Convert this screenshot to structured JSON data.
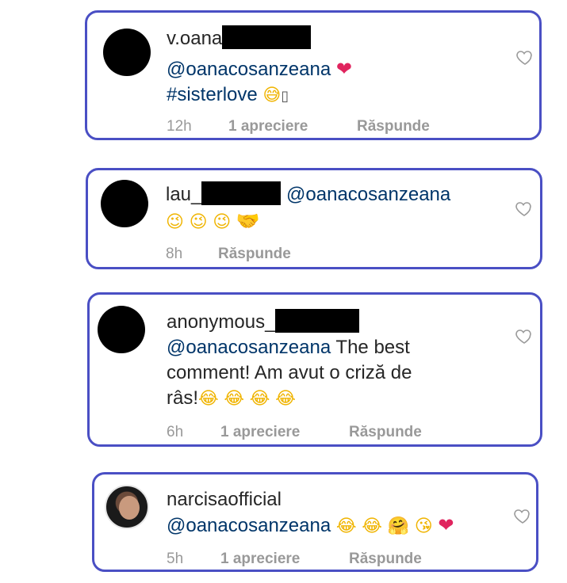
{
  "comments": [
    {
      "username": "v.oana",
      "mention": "@oanacosanzeana",
      "heart_icon": "red-heart-icon",
      "hashtag": "#sisterlove",
      "emojis": [
        "😅",
        "🩷"
      ],
      "time": "12h",
      "likes": "1 apreciere",
      "reply": "Răspunde"
    },
    {
      "username": "lau_",
      "mention": "@oanacosanzeana",
      "emojis": [
        "😉",
        "😉",
        "😉",
        "🤝"
      ],
      "time": "8h",
      "reply": "Răspunde"
    },
    {
      "username": "anonymous_",
      "mention": "@oanacosanzeana",
      "text_a": " The best",
      "text_b": "comment! Am avut o criză de",
      "text_c": "râs!",
      "emojis": [
        "😂",
        "😂",
        "😂",
        "😂"
      ],
      "time": "6h",
      "likes": "1 apreciere",
      "reply": "Răspunde"
    },
    {
      "username": "narcisaofficial",
      "mention": "@oanacosanzeana",
      "emojis": [
        "😂",
        "😂",
        "🤗",
        "😘",
        "❤"
      ],
      "time": "5h",
      "likes": "1 apreciere",
      "reply": "Răspunde"
    }
  ],
  "icons": {
    "like": "heart-outline-icon"
  },
  "colors": {
    "border": "#4a4fc4",
    "mention": "#003569",
    "meta": "#999999"
  }
}
